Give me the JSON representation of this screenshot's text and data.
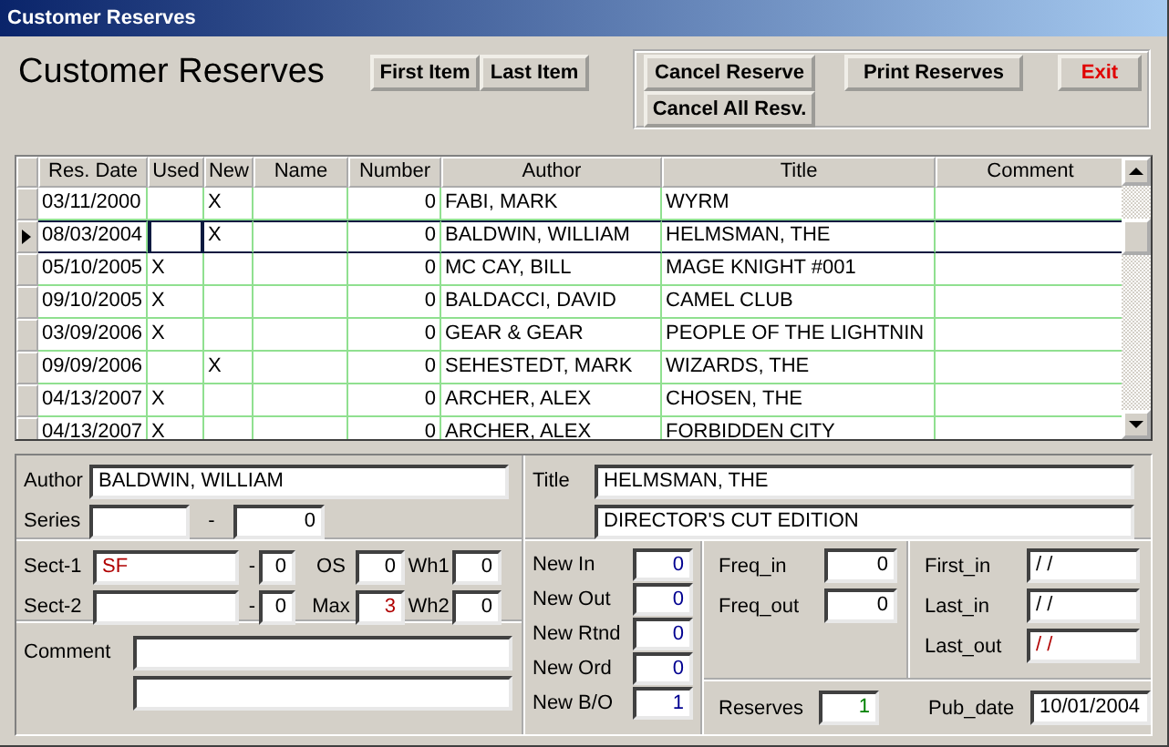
{
  "window": {
    "title": "Customer Reserves"
  },
  "heading": "Customer Reserves",
  "nav_buttons": [
    {
      "label": "First Item"
    },
    {
      "label": "Last Item"
    }
  ],
  "action_buttons": [
    {
      "label": "Cancel Reserve",
      "kind": "stacked"
    },
    {
      "label": "Cancel All Resv.",
      "kind": "stacked"
    },
    {
      "label": "Print Reserves",
      "kind": "wide"
    },
    {
      "label": "Exit",
      "kind": "exit",
      "color": "#e00000"
    }
  ],
  "table": {
    "columns": [
      "Res. Date",
      "Used",
      "New",
      "Name",
      "Number",
      "Author",
      "Title",
      "Comment"
    ],
    "rows": [
      {
        "res_date": "03/11/2000",
        "new": "X",
        "number": "0",
        "author": "FABI, MARK",
        "title": "WYRM",
        "selected": false
      },
      {
        "res_date": "08/03/2004",
        "new": "X",
        "number": "0",
        "author": "BALDWIN, WILLIAM",
        "title": "HELMSMAN, THE",
        "selected": true
      },
      {
        "res_date": "05/10/2005",
        "used": "X",
        "number": "0",
        "author": "MC CAY, BILL",
        "title": "MAGE KNIGHT #001",
        "selected": false
      },
      {
        "res_date": "09/10/2005",
        "used": "X",
        "number": "0",
        "author": "BALDACCI, DAVID",
        "title": "CAMEL CLUB",
        "selected": false
      },
      {
        "res_date": "03/09/2006",
        "used": "X",
        "number": "0",
        "author": "GEAR & GEAR",
        "title": "PEOPLE OF THE LIGHTNIN",
        "selected": false
      },
      {
        "res_date": "09/09/2006",
        "new": "X",
        "number": "0",
        "author": "SEHESTEDT, MARK",
        "title": "WIZARDS, THE",
        "selected": false
      },
      {
        "res_date": "04/13/2007",
        "used": "X",
        "number": "0",
        "author": "ARCHER, ALEX",
        "title": "CHOSEN, THE",
        "selected": false
      },
      {
        "res_date": "04/13/2007",
        "used": "X",
        "number": "0",
        "author": "ARCHER, ALEX",
        "title": "FORBIDDEN CITY",
        "selected": false
      }
    ]
  },
  "author": {
    "label": "Author",
    "value": "BALDWIN, WILLIAM"
  },
  "series": {
    "label": "Series",
    "separator": "-",
    "number": "0"
  },
  "sections": [
    {
      "label": "Sect-1",
      "value": "SF",
      "color": "#b00000",
      "separator": "-",
      "number": "0",
      "extras": [
        {
          "label": "OS",
          "value": "0"
        },
        {
          "label": "Wh1",
          "value": "0"
        }
      ]
    },
    {
      "label": "Sect-2",
      "separator": "-",
      "number": "0",
      "extras": [
        {
          "label": "Max",
          "value": "3",
          "color": "#b00000"
        },
        {
          "label": "Wh2",
          "value": "0"
        }
      ]
    }
  ],
  "comment": {
    "label": "Comment"
  },
  "title": {
    "label": "Title",
    "lines": [
      "HELMSMAN, THE",
      "DIRECTOR'S CUT EDITION"
    ]
  },
  "new_counts": [
    {
      "label": "New In",
      "value": "0",
      "color": "#000090"
    },
    {
      "label": "New Out",
      "value": "0",
      "color": "#000090"
    },
    {
      "label": "New Rtnd",
      "value": "0",
      "color": "#000090"
    },
    {
      "label": "New Ord",
      "value": "0",
      "color": "#000090"
    },
    {
      "label": "New B/O",
      "value": "1",
      "color": "#000090"
    }
  ],
  "freq": [
    {
      "label": "Freq_in",
      "value": "0"
    },
    {
      "label": "Freq_out",
      "value": "0"
    }
  ],
  "dates": [
    {
      "label": "First_in",
      "value": "/ /"
    },
    {
      "label": "Last_in",
      "value": "/ /"
    },
    {
      "label": "Last_out",
      "value": "/ /",
      "color": "#b00000"
    }
  ],
  "reserves": {
    "label": "Reserves",
    "value": "1",
    "color": "#008000"
  },
  "pub_date": {
    "label": "Pub_date",
    "value": "10/01/2004"
  }
}
